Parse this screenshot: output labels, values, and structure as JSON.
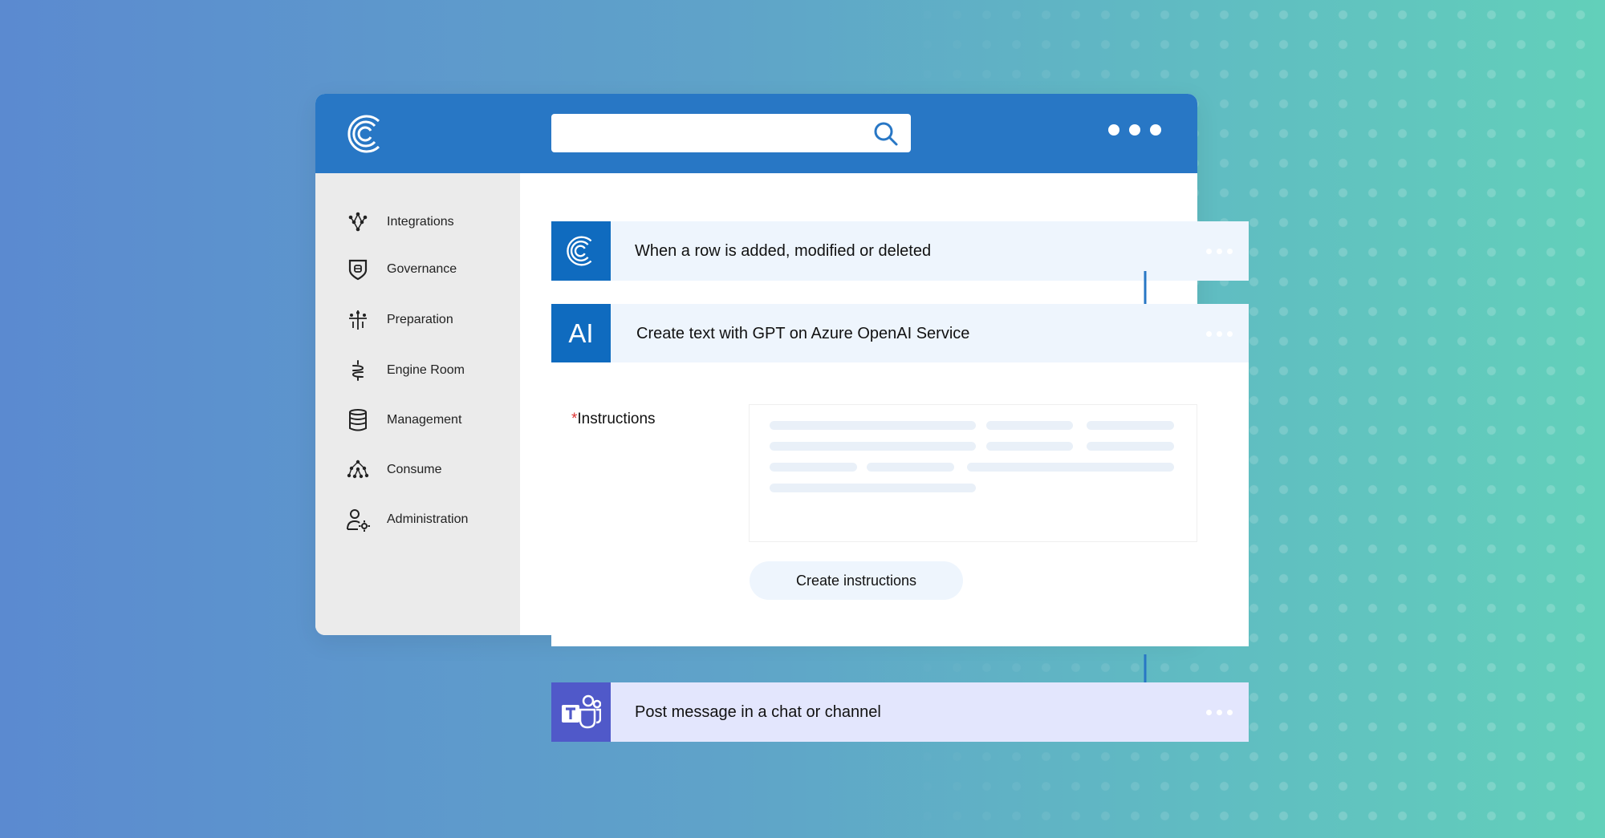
{
  "search": {
    "placeholder": "",
    "value": ""
  },
  "sidebar": {
    "items": [
      {
        "label": "Integrations",
        "icon": "integrations-icon"
      },
      {
        "label": "Governance",
        "icon": "shield-icon"
      },
      {
        "label": "Preparation",
        "icon": "preparation-icon"
      },
      {
        "label": "Engine Room",
        "icon": "engine-room-icon"
      },
      {
        "label": "Management",
        "icon": "database-icon"
      },
      {
        "label": "Consume",
        "icon": "consume-icon"
      },
      {
        "label": "Administration",
        "icon": "user-settings-icon"
      }
    ]
  },
  "flow": {
    "step1": {
      "title": "When a row is added, modified or deleted",
      "icon": "c-logo-icon"
    },
    "step2": {
      "title": "Create text with GPT on Azure OpenAI Service",
      "badge": "AI"
    },
    "step3": {
      "title": "Post message in a chat or channel",
      "icon": "teams-icon"
    }
  },
  "form": {
    "required_mark": "*",
    "instructions_label": "Instructions",
    "create_button": "Create instructions"
  },
  "colors": {
    "brand_blue": "#2877c5",
    "badge_blue": "#0f6bbf",
    "teams_purple": "#5059c9",
    "card_bg": "#eef5fd",
    "teams_card_bg": "#e3e6fd",
    "sidebar_bg": "#ebebeb"
  }
}
